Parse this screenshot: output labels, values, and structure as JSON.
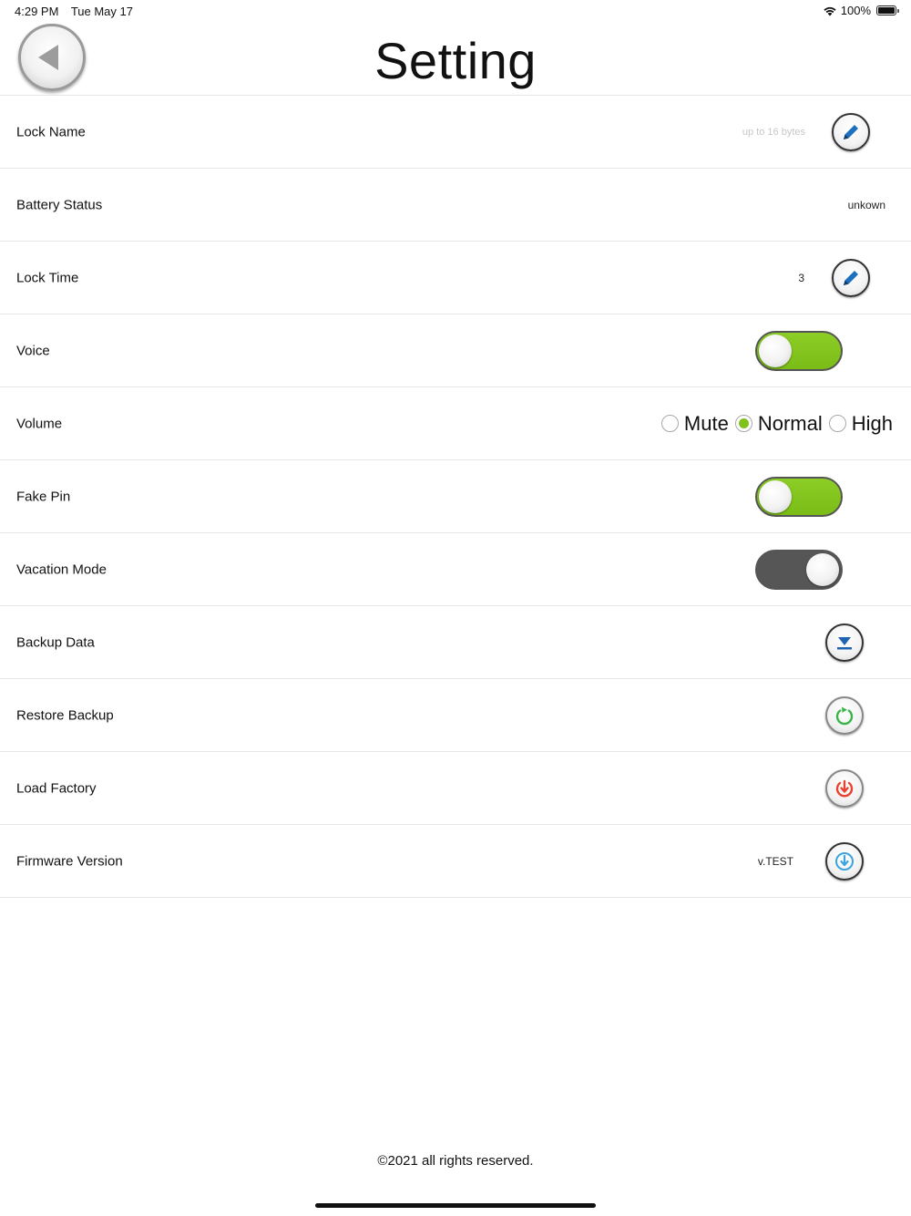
{
  "status_bar": {
    "time": "4:29 PM",
    "date": "Tue May 17",
    "battery": "100%"
  },
  "header": {
    "title": "Setting"
  },
  "settings": {
    "lock_name": {
      "label": "Lock Name",
      "placeholder": "up to 16 bytes"
    },
    "battery_status": {
      "label": "Battery Status",
      "value": "unkown"
    },
    "lock_time": {
      "label": "Lock Time",
      "value": "3"
    },
    "voice": {
      "label": "Voice",
      "state": "on"
    },
    "volume": {
      "label": "Volume",
      "options": [
        "Mute",
        "Normal",
        "High"
      ],
      "selected": "Normal"
    },
    "fake_pin": {
      "label": "Fake Pin",
      "state": "on"
    },
    "vacation_mode": {
      "label": "Vacation Mode",
      "state": "off"
    },
    "backup_data": {
      "label": "Backup Data"
    },
    "restore_backup": {
      "label": "Restore Backup"
    },
    "load_factory": {
      "label": "Load Factory"
    },
    "firmware_version": {
      "label": "Firmware Version",
      "value": "v.TEST"
    }
  },
  "footer": {
    "copyright": "©2021 all rights reserved."
  },
  "colors": {
    "toggle_on": "#80c11c",
    "toggle_off": "#565656",
    "edit_icon": "#1f6fbf",
    "backup_icon": "#1f63b5",
    "restore_icon": "#3bb54a",
    "factory_icon": "#e8432f",
    "firmware_icon": "#3ba3e0"
  },
  "icons": {
    "back": "back-arrow-icon",
    "edit": "pencil-icon",
    "backup": "download-to-tray-icon",
    "restore": "refresh-icon",
    "factory": "power-reset-icon",
    "firmware": "update-icon"
  }
}
